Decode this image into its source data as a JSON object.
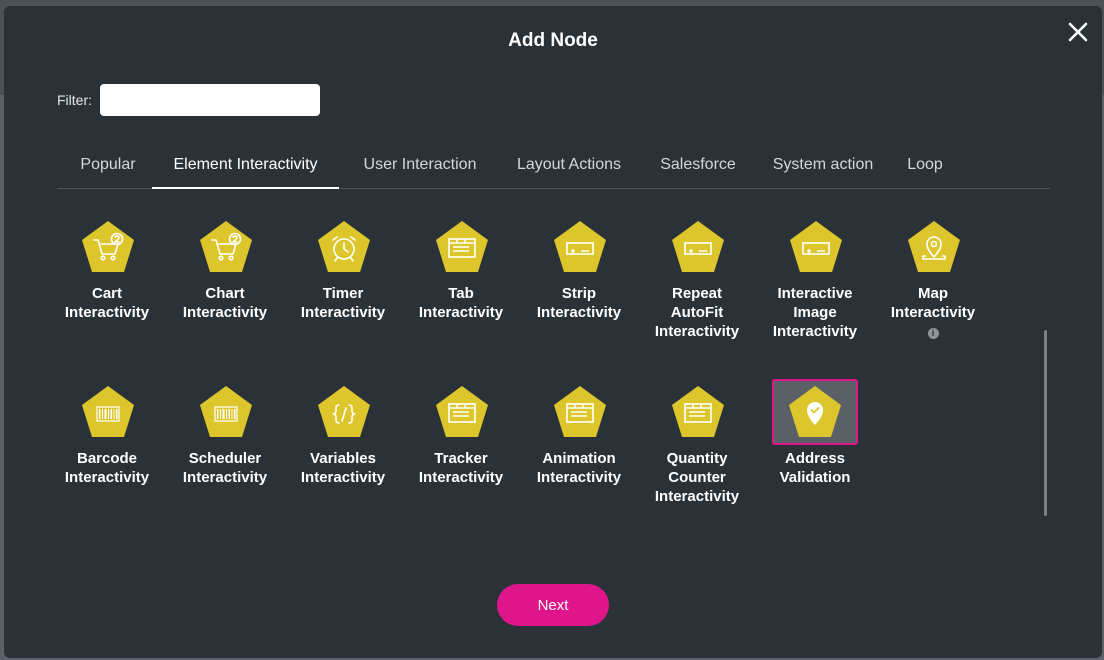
{
  "dialog": {
    "title": "Add Node",
    "close_icon": "close-icon"
  },
  "filter": {
    "label": "Filter:",
    "value": "",
    "placeholder": ""
  },
  "tabs": [
    {
      "label": "Popular",
      "active": false
    },
    {
      "label": "Element Interactivity",
      "active": true
    },
    {
      "label": "User Interaction",
      "active": false
    },
    {
      "label": "Layout Actions",
      "active": false
    },
    {
      "label": "Salesforce",
      "active": false
    },
    {
      "label": "System action",
      "active": false
    },
    {
      "label": "Loop",
      "active": false
    }
  ],
  "nodes": [
    {
      "line1": "Cart",
      "line2": "Interactivity",
      "line3": "",
      "icon": "cart-icon"
    },
    {
      "line1": "Chart",
      "line2": "Interactivity",
      "line3": "",
      "icon": "cart-icon"
    },
    {
      "line1": "Timer",
      "line2": "Interactivity",
      "line3": "",
      "icon": "alarm-clock-icon"
    },
    {
      "line1": "Tab",
      "line2": "Interactivity",
      "line3": "",
      "icon": "tab-folder-icon"
    },
    {
      "line1": "Strip",
      "line2": "Interactivity",
      "line3": "",
      "icon": "strip-icon"
    },
    {
      "line1": "Repeat",
      "line2": "AutoFit",
      "line3": "Interactivity",
      "icon": "strip-icon"
    },
    {
      "line1": "Interactive",
      "line2": "Image",
      "line3": "Interactivity",
      "icon": "strip-icon"
    },
    {
      "line1": "Map",
      "line2": "Interactivity",
      "line3": "",
      "icon": "map-pin-icon",
      "info": "i"
    },
    {
      "line1": "Barcode",
      "line2": "Interactivity",
      "line3": "",
      "icon": "barcode-icon"
    },
    {
      "line1": "Scheduler",
      "line2": "Interactivity",
      "line3": "",
      "icon": "barcode-icon"
    },
    {
      "line1": "Variables",
      "line2": "Interactivity",
      "line3": "",
      "icon": "braces-icon"
    },
    {
      "line1": "Tracker",
      "line2": "Interactivity",
      "line3": "",
      "icon": "tab-folder-icon"
    },
    {
      "line1": "Animation",
      "line2": "Interactivity",
      "line3": "",
      "icon": "tab-folder-icon"
    },
    {
      "line1": "Quantity",
      "line2": "Counter",
      "line3": "Interactivity",
      "icon": "tab-folder-icon"
    },
    {
      "line1": "Address",
      "line2": "Validation",
      "line3": "",
      "icon": "address-check-icon",
      "selected": true
    }
  ],
  "footer": {
    "next_label": "Next"
  },
  "colors": {
    "dialog_bg": "#2b3237",
    "hexagon": "#dcc62b",
    "accent": "#e0158b",
    "text": "#ffffff"
  }
}
